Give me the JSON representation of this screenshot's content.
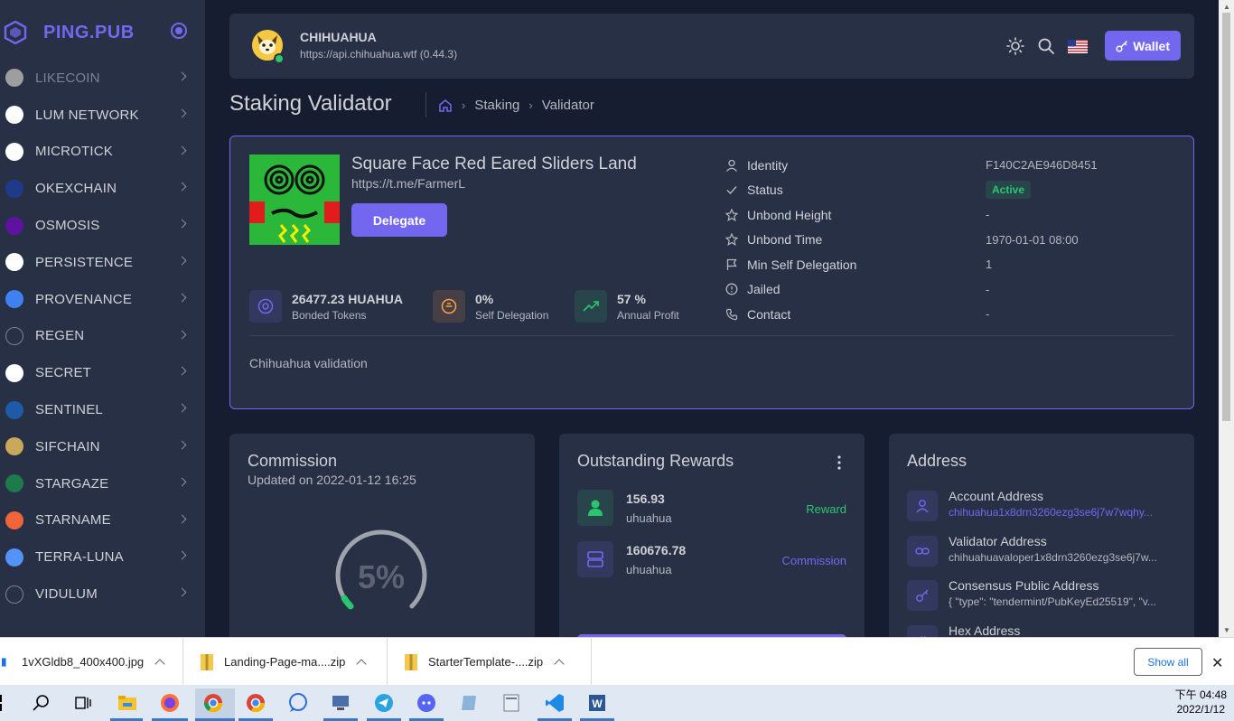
{
  "app": {
    "brand": "PING.PUB",
    "accent": "#7367f0"
  },
  "sidebar": {
    "items": [
      {
        "label": "LIKECOIN",
        "icon": "likecoin-icon",
        "color": "#9e9e9e"
      },
      {
        "label": "LUM NETWORK",
        "icon": "lum-network-icon",
        "color": "#ffffff"
      },
      {
        "label": "MICROTICK",
        "icon": "microtick-icon",
        "color": "#ffffff"
      },
      {
        "label": "OKEXCHAIN",
        "icon": "okexchain-icon",
        "color": "#1e3a8a"
      },
      {
        "label": "OSMOSIS",
        "icon": "osmosis-icon",
        "color": "#5e12a0"
      },
      {
        "label": "PERSISTENCE",
        "icon": "persistence-icon",
        "color": "#ffffff"
      },
      {
        "label": "PROVENANCE",
        "icon": "provenance-icon",
        "color": "#3f80f3"
      },
      {
        "label": "REGEN",
        "icon": "regen-icon",
        "color": "#283046"
      },
      {
        "label": "SECRET",
        "icon": "secret-icon",
        "color": "#ffffff"
      },
      {
        "label": "SENTINEL",
        "icon": "sentinel-icon",
        "color": "#1e5aa8"
      },
      {
        "label": "SIFCHAIN",
        "icon": "sifchain-icon",
        "color": "#c8a85a"
      },
      {
        "label": "STARGAZE",
        "icon": "stargaze-icon",
        "color": "#1f7a4a"
      },
      {
        "label": "STARNAME",
        "icon": "starname-icon",
        "color": "#f0643c"
      },
      {
        "label": "TERRA-LUNA",
        "icon": "terra-luna-icon",
        "color": "#5493f7"
      },
      {
        "label": "VIDULUM",
        "icon": "vidulum-icon",
        "color": "#283046"
      }
    ]
  },
  "header": {
    "chain_name": "CHIHUAHUA",
    "chain_api": "https://api.chihuahua.wtf (0.44.3)",
    "wallet_label": "Wallet"
  },
  "breadcrumb": {
    "title": "Staking Validator",
    "items": [
      "Staking",
      "Validator"
    ]
  },
  "validator": {
    "name": "Square Face Red Eared Sliders Land",
    "url": "https://t.me/FarmerL",
    "delegate_label": "Delegate",
    "stats": [
      {
        "value": "26477.23 HUAHUA",
        "label": "Bonded Tokens",
        "color": "#7367f0"
      },
      {
        "value": "0%",
        "label": "Self Delegation",
        "color": "#ff9f43"
      },
      {
        "value": "57 %",
        "label": "Annual Profit",
        "color": "#28c76f"
      }
    ],
    "info": [
      {
        "key": "Identity",
        "value": "F140C2AE946D8451"
      },
      {
        "key": "Status",
        "value": "Active"
      },
      {
        "key": "Unbond Height",
        "value": "-"
      },
      {
        "key": "Unbond Time",
        "value": "1970-01-01 08:00"
      },
      {
        "key": "Min Self Delegation",
        "value": "1"
      },
      {
        "key": "Jailed",
        "value": "-"
      },
      {
        "key": "Contact",
        "value": "-"
      }
    ],
    "description": "Chihuahua validation"
  },
  "commission": {
    "title": "Commission",
    "updated": "Updated on 2022-01-12 16:25",
    "rate_text": "5%",
    "rate": 0.05
  },
  "rewards": {
    "title": "Outstanding Rewards",
    "items": [
      {
        "amount": "156.93",
        "denom": "uhuahua",
        "tag": "Reward",
        "color": "#28c76f"
      },
      {
        "amount": "160676.78",
        "denom": "uhuahua",
        "tag": "Commission",
        "color": "#7367f0"
      }
    ]
  },
  "address": {
    "title": "Address",
    "items": [
      {
        "key": "Account Address",
        "value": "chihuahua1x8drn3260ezg3se6j7w7wqhy..."
      },
      {
        "key": "Validator Address",
        "value": "chihuahuavaloper1x8drn3260ezg3se6j7w..."
      },
      {
        "key": "Consensus Public Address",
        "value": "{ \"type\": \"tendermint/PubKeyEd25519\", \"v..."
      },
      {
        "key": "Hex Address",
        "value": ""
      }
    ]
  },
  "downloads": {
    "items": [
      "1vXGldb8_400x400.jpg",
      "Landing-Page-ma....zip",
      "StarterTemplate-....zip"
    ],
    "show_all": "Show all"
  },
  "taskbar": {
    "time": "下午 04:48",
    "date": "2022/1/12"
  }
}
